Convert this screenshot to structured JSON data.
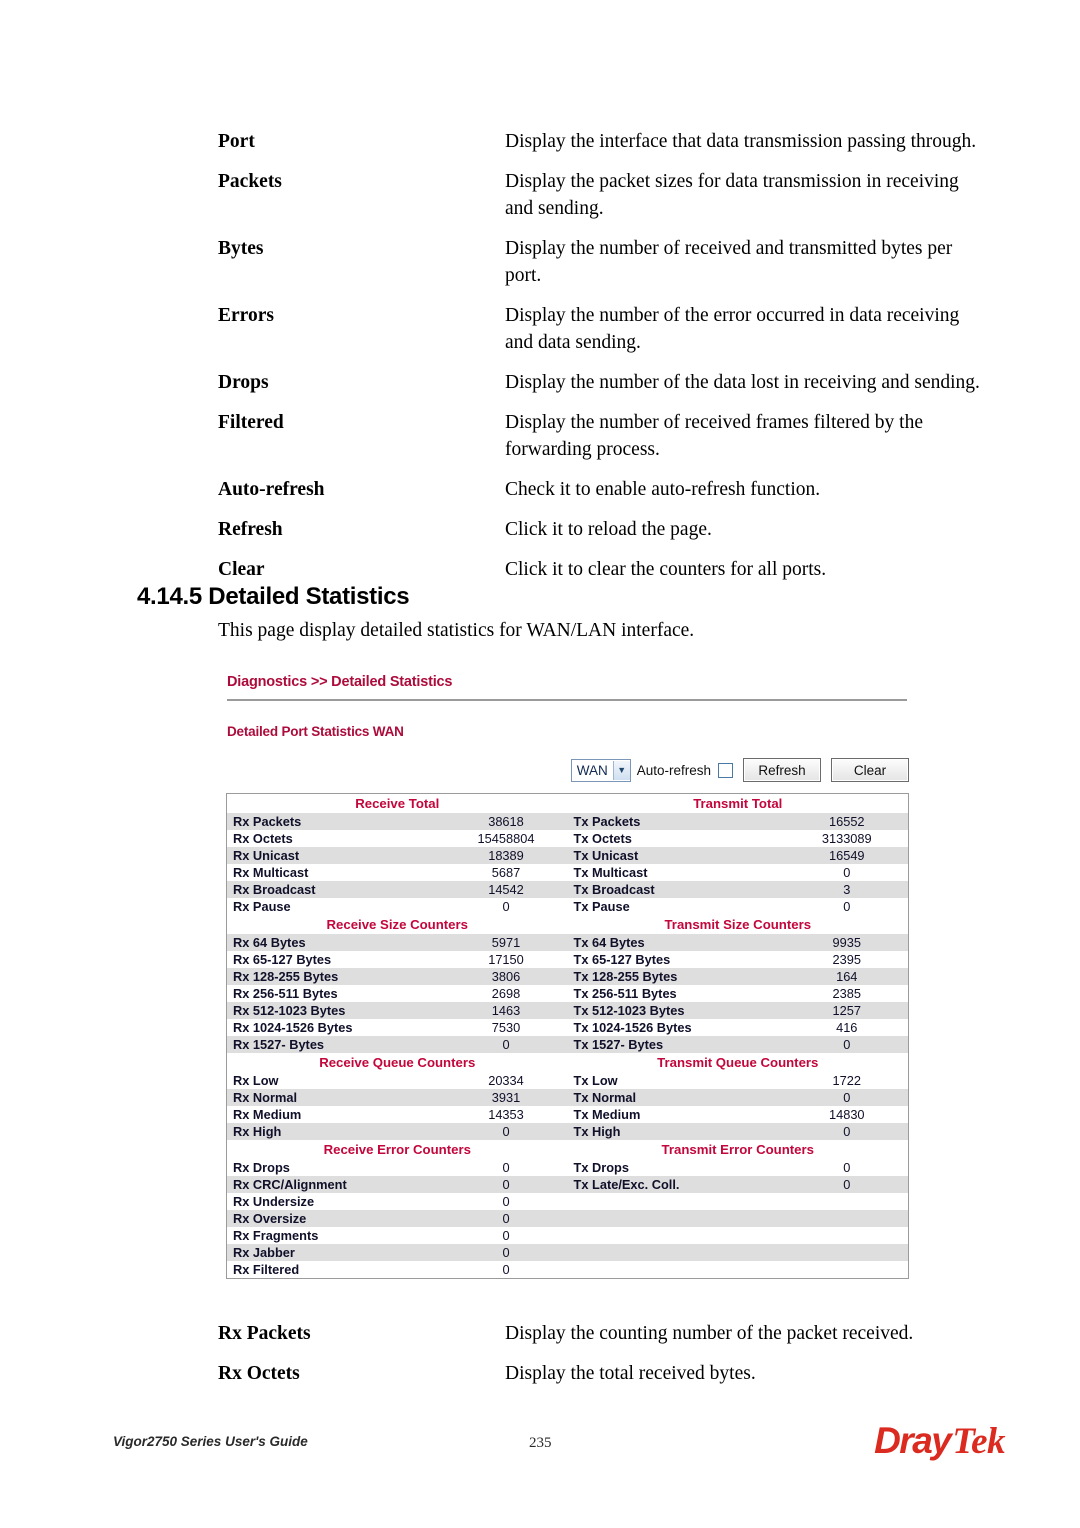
{
  "document": {
    "glossary_top": [
      {
        "term": "Port",
        "desc": "Display the interface that data transmission passing through."
      },
      {
        "term": "Packets",
        "desc": "Display the packet sizes for data transmission in receiving and sending."
      },
      {
        "term": "Bytes",
        "desc": "Display the number of received and transmitted bytes per port."
      },
      {
        "term": "Errors",
        "desc": "Display the number of the error occurred in data receiving and data sending."
      },
      {
        "term": "Drops",
        "desc": "Display the number of the data lost in receiving and sending."
      },
      {
        "term": "Filtered",
        "desc": "Display the number of received frames filtered by the forwarding process."
      },
      {
        "term": "Auto-refresh",
        "desc": "Check it to enable auto-refresh function."
      },
      {
        "term": "Refresh",
        "desc": "Click it to reload the page."
      },
      {
        "term": "Clear",
        "desc": "Click it to clear the counters for all ports."
      }
    ],
    "section_heading": "4.14.5 Detailed Statistics",
    "intro_text": "This page display detailed statistics for WAN/LAN interface.",
    "glossary_bottom": [
      {
        "term": "Rx Packets",
        "desc": "Display the counting number of the packet received."
      },
      {
        "term": "Rx Octets",
        "desc": "Display the total received bytes."
      }
    ],
    "footer": {
      "guide": "Vigor2750 Series User's Guide",
      "page": "235",
      "logo_part1": "Dray",
      "logo_part2": "Tek"
    }
  },
  "screenshot": {
    "breadcrumb": "Diagnostics >> Detailed Statistics",
    "subtitle": "Detailed Port Statistics  WAN",
    "controls": {
      "port_select_value": "WAN",
      "port_select_arrow": "▼",
      "auto_refresh_label": "Auto-refresh",
      "auto_refresh_checked": false,
      "refresh_button": "Refresh",
      "clear_button": "Clear"
    },
    "accent_color": "#AD0B3B",
    "section_color": "#C3063B",
    "table": {
      "sections": [
        {
          "left_header": "Receive Total",
          "right_header": "Transmit Total",
          "rows": [
            {
              "l": "Rx Packets",
              "lv": "38618",
              "r": "Tx Packets",
              "rv": "16552"
            },
            {
              "l": "Rx Octets",
              "lv": "15458804",
              "r": "Tx Octets",
              "rv": "3133089"
            },
            {
              "l": "Rx Unicast",
              "lv": "18389",
              "r": "Tx Unicast",
              "rv": "16549"
            },
            {
              "l": "Rx Multicast",
              "lv": "5687",
              "r": "Tx Multicast",
              "rv": "0"
            },
            {
              "l": "Rx Broadcast",
              "lv": "14542",
              "r": "Tx Broadcast",
              "rv": "3"
            },
            {
              "l": "Rx Pause",
              "lv": "0",
              "r": "Tx Pause",
              "rv": "0"
            }
          ]
        },
        {
          "left_header": "Receive Size Counters",
          "right_header": "Transmit Size Counters",
          "rows": [
            {
              "l": "Rx 64 Bytes",
              "lv": "5971",
              "r": "Tx 64 Bytes",
              "rv": "9935"
            },
            {
              "l": "Rx 65-127 Bytes",
              "lv": "17150",
              "r": "Tx 65-127 Bytes",
              "rv": "2395"
            },
            {
              "l": "Rx 128-255 Bytes",
              "lv": "3806",
              "r": "Tx 128-255 Bytes",
              "rv": "164"
            },
            {
              "l": "Rx 256-511 Bytes",
              "lv": "2698",
              "r": "Tx 256-511 Bytes",
              "rv": "2385"
            },
            {
              "l": "Rx 512-1023 Bytes",
              "lv": "1463",
              "r": "Tx 512-1023 Bytes",
              "rv": "1257"
            },
            {
              "l": "Rx 1024-1526 Bytes",
              "lv": "7530",
              "r": "Tx 1024-1526 Bytes",
              "rv": "416"
            },
            {
              "l": "Rx 1527- Bytes",
              "lv": "0",
              "r": "Tx 1527- Bytes",
              "rv": "0"
            }
          ]
        },
        {
          "left_header": "Receive Queue Counters",
          "right_header": "Transmit Queue Counters",
          "rows": [
            {
              "l": "Rx Low",
              "lv": "20334",
              "r": "Tx Low",
              "rv": "1722"
            },
            {
              "l": "Rx Normal",
              "lv": "3931",
              "r": "Tx Normal",
              "rv": "0"
            },
            {
              "l": "Rx Medium",
              "lv": "14353",
              "r": "Tx Medium",
              "rv": "14830"
            },
            {
              "l": "Rx High",
              "lv": "0",
              "r": "Tx High",
              "rv": "0"
            }
          ]
        },
        {
          "left_header": "Receive Error Counters",
          "right_header": "Transmit Error Counters",
          "rows": [
            {
              "l": "Rx Drops",
              "lv": "0",
              "r": "Tx Drops",
              "rv": "0"
            },
            {
              "l": "Rx CRC/Alignment",
              "lv": "0",
              "r": "Tx Late/Exc. Coll.",
              "rv": "0"
            },
            {
              "l": "Rx Undersize",
              "lv": "0",
              "r": "",
              "rv": ""
            },
            {
              "l": "Rx Oversize",
              "lv": "0",
              "r": "",
              "rv": ""
            },
            {
              "l": "Rx Fragments",
              "lv": "0",
              "r": "",
              "rv": ""
            },
            {
              "l": "Rx Jabber",
              "lv": "0",
              "r": "",
              "rv": ""
            },
            {
              "l": "Rx Filtered",
              "lv": "0",
              "r": "",
              "rv": ""
            }
          ]
        }
      ]
    }
  }
}
